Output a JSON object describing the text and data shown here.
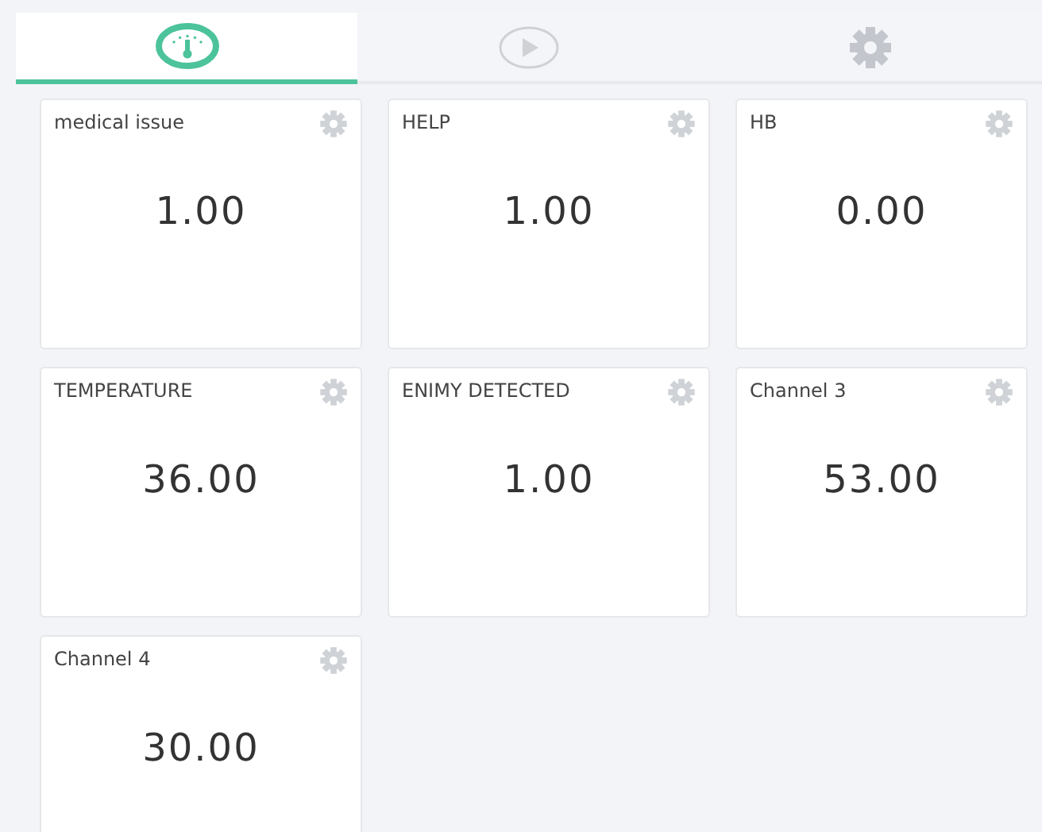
{
  "tabs": [
    {
      "kind": "gauge",
      "selected": true
    },
    {
      "kind": "play",
      "selected": false
    },
    {
      "kind": "gear",
      "selected": false
    }
  ],
  "cards": [
    {
      "label": "medical issue",
      "value": "1.00"
    },
    {
      "label": "HELP",
      "value": "1.00"
    },
    {
      "label": "HB",
      "value": "0.00"
    },
    {
      "label": "TEMPERATURE",
      "value": "36.00"
    },
    {
      "label": "ENIMY DETECTED",
      "value": "1.00"
    },
    {
      "label": "Channel 3",
      "value": "53.00"
    },
    {
      "label": "Channel 4",
      "value": "30.00"
    }
  ]
}
